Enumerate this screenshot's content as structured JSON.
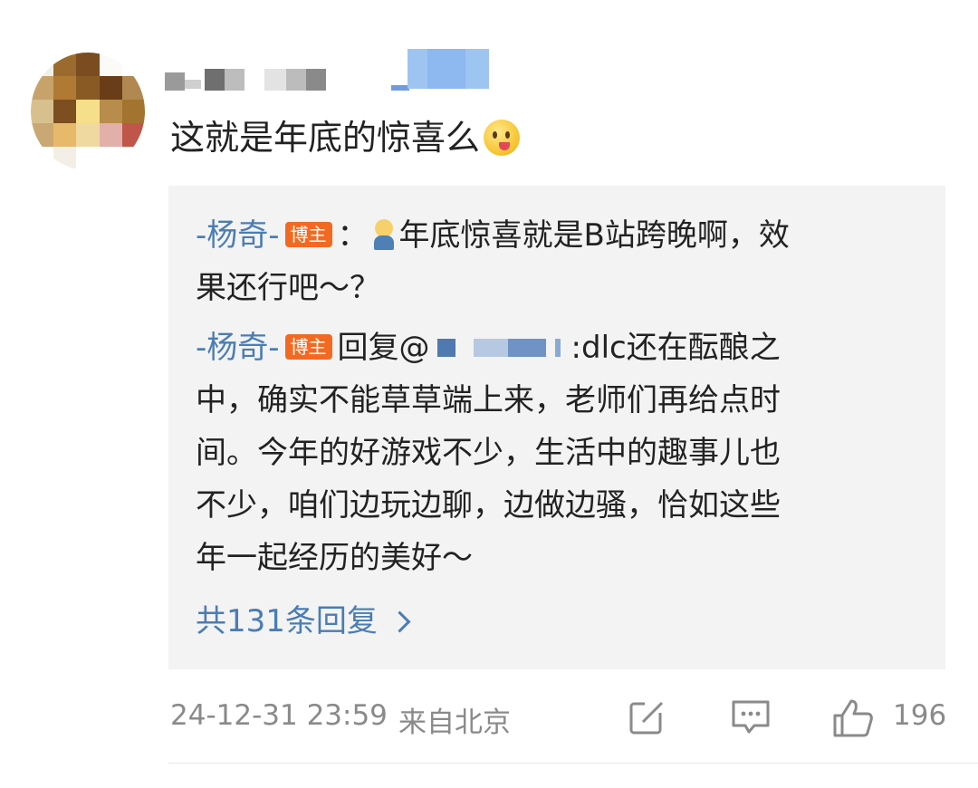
{
  "comment": {
    "text": "这就是年底的惊喜么",
    "emoji_icon": "tongue-out-face-emoji"
  },
  "replies": [
    {
      "author": "-杨奇-",
      "badge": "博主",
      "separator": "：",
      "emoji_icon": "person-sitting-emoji",
      "text_line1": "年底惊喜就是B站跨晚啊，效",
      "text_line2": "果还行吧～？"
    },
    {
      "author": "-杨奇-",
      "badge": "博主",
      "reply_prefix": "回复@",
      "after_mention": ":dlc还在酝酿之",
      "lines": [
        "中，确实不能草草端上来，老师们再给点时",
        "间。今年的好游戏不少，生活中的趣事儿也",
        "不少，咱们边玩边聊，边做边骚，恰如这些",
        "年一起经历的美好～"
      ]
    }
  ],
  "more_replies": "共131条回复",
  "footer": {
    "timestamp": "24-12-31 23:59",
    "location": "来自北京",
    "like_count": "196",
    "icons": [
      "repost-icon",
      "comment-icon",
      "like-icon"
    ]
  },
  "colors": {
    "link": "#4a7db3",
    "badge": "#f26a22",
    "reply_bg": "#f3f3f3",
    "meta_text": "#8a8a8a"
  }
}
